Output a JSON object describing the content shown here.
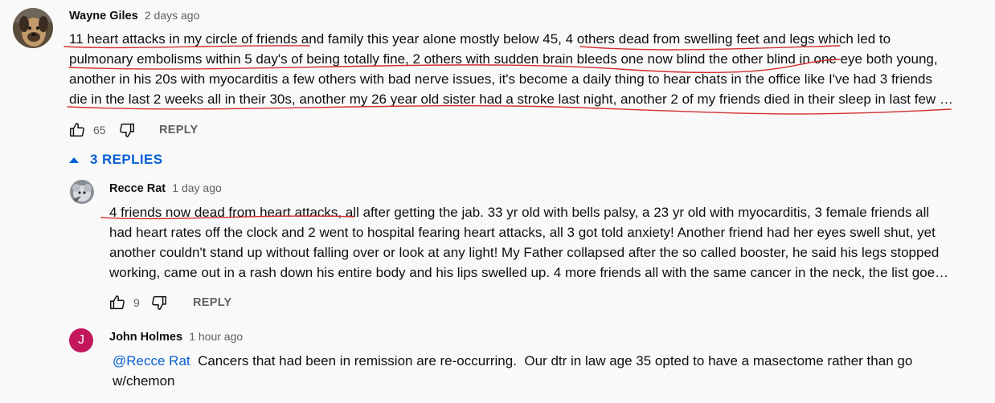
{
  "comments": [
    {
      "author": "Wayne Giles",
      "timestamp": "2 days ago",
      "lines": [
        "11 heart attacks in my circle of friends and family this year alone mostly below 45, 4 others dead from swelling feet and legs which led to",
        "pulmonary embolisms within 5 day's of being totally fine, 2 others with sudden brain bleeds one now blind the other blind in one eye both young,",
        "another in his 20s with myocarditis a few others with bad nerve issues, it's become a daily thing to hear chats in the office like I've had 3 friends",
        "die in the last 2 weeks all in their 30s, another my 26 year old sister had a stroke last night, another 2 of my friends died in their sleep in last few …"
      ],
      "like_count": "65",
      "reply_label": "REPLY"
    }
  ],
  "replies_toggle": {
    "label": "3 REPLIES"
  },
  "replies": [
    {
      "author": "Recce Rat",
      "timestamp": "1 day ago",
      "lines": [
        "4 friends now dead from heart attacks, all after getting the jab. 33 yr old with bells palsy, a 23 yr old with myocarditis, 3 female friends all",
        "had heart rates off the clock and 2 went to hospital fearing heart attacks, all 3 got told anxiety! Another friend had her eyes swell shut, yet",
        "another couldn't stand up without falling over or look at any light! My Father collapsed after the so called booster, he said his legs stopped",
        "working, came out in a rash down his entire body and his lips swelled up. 4 more friends all with the same cancer in the neck, the list goe…"
      ],
      "like_count": "9",
      "reply_label": "REPLY"
    },
    {
      "author": "John Holmes",
      "timestamp": "1 hour ago",
      "avatar_letter": "J",
      "mention": "@Recce Rat",
      "line1_rest": "  Cancers that had been in remission are re-occurring.  Our dtr in law age 35 opted to have a masectome rather than go",
      "line2": "w/chemon"
    }
  ],
  "colors": {
    "background": "#f9f9f9",
    "link_blue": "#065fd4",
    "secondary_text": "#606060",
    "avatar_j": "#c2185b",
    "annotation_red": "#d32f2f"
  }
}
